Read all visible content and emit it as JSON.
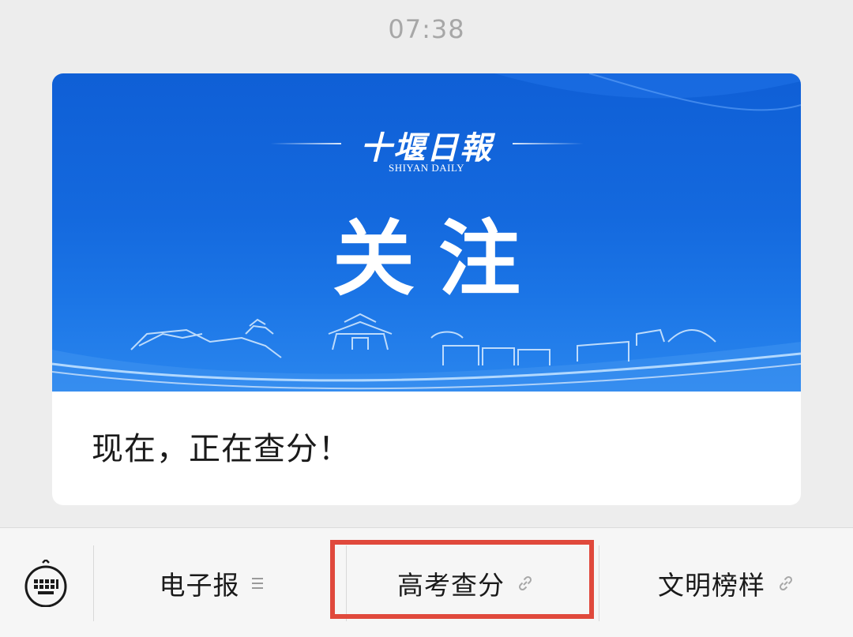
{
  "status": {
    "time": "07:38"
  },
  "card": {
    "banner": {
      "masthead": "十堰日報",
      "masthead_en": "SHIYAN DAILY",
      "headline": "关注"
    },
    "caption": "现在，正在查分！"
  },
  "menu": {
    "items": [
      {
        "label": "电子报",
        "icon": "list-icon"
      },
      {
        "label": "高考查分",
        "icon": "link-icon"
      },
      {
        "label": "文明榜样",
        "icon": "link-icon"
      }
    ],
    "keyboard_icon": "keyboard-icon"
  },
  "colors": {
    "banner_blue": "#1469de",
    "highlight_red": "#e0493c",
    "background": "#ededed"
  }
}
